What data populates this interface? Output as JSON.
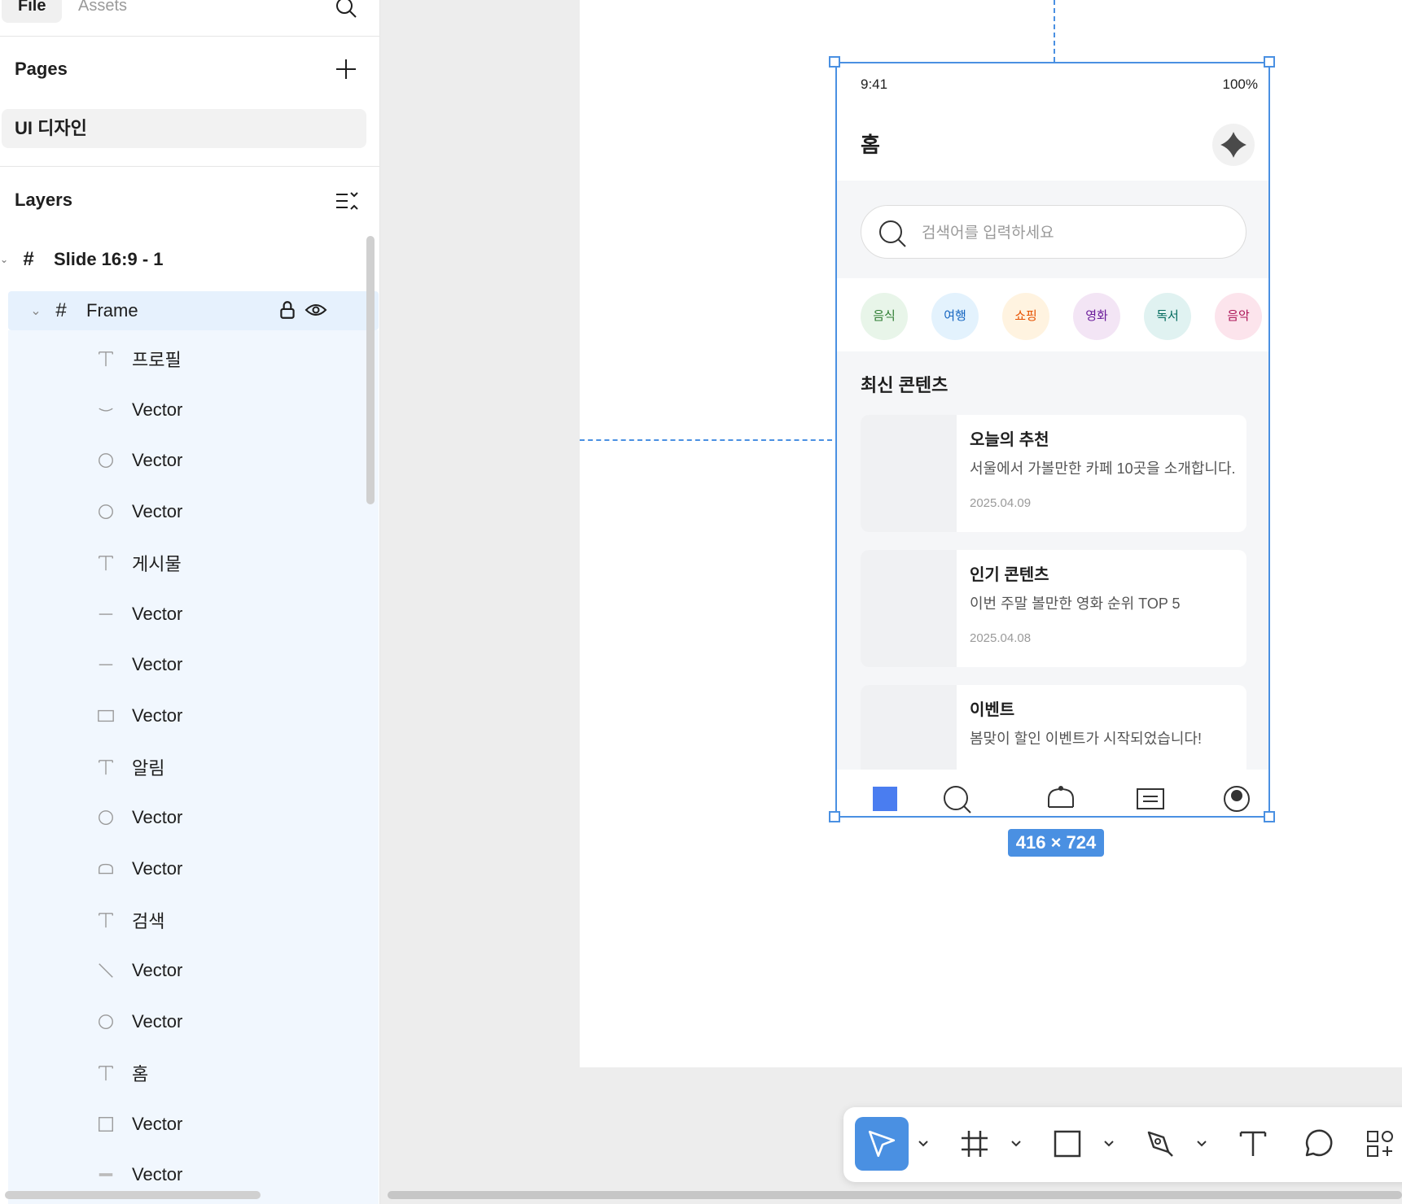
{
  "sidebar": {
    "tabs": {
      "file": "File",
      "assets": "Assets"
    },
    "pages_title": "Pages",
    "page_item": "UI 디자인",
    "layers_title": "Layers",
    "slide_name": "Slide 16:9 - 1",
    "frame_name": "Frame",
    "layers": [
      {
        "label": "프로필",
        "icon": "text"
      },
      {
        "label": "Vector",
        "icon": "arc"
      },
      {
        "label": "Vector",
        "icon": "circle"
      },
      {
        "label": "Vector",
        "icon": "circle"
      },
      {
        "label": "게시물",
        "icon": "text"
      },
      {
        "label": "Vector",
        "icon": "line"
      },
      {
        "label": "Vector",
        "icon": "line"
      },
      {
        "label": "Vector",
        "icon": "rect"
      },
      {
        "label": "알림",
        "icon": "text"
      },
      {
        "label": "Vector",
        "icon": "circle"
      },
      {
        "label": "Vector",
        "icon": "half-rect"
      },
      {
        "label": "검색",
        "icon": "text"
      },
      {
        "label": "Vector",
        "icon": "diagonal"
      },
      {
        "label": "Vector",
        "icon": "circle"
      },
      {
        "label": "홈",
        "icon": "text"
      },
      {
        "label": "Vector",
        "icon": "square"
      },
      {
        "label": "Vector",
        "icon": "bar"
      }
    ]
  },
  "canvas": {
    "dimension_label": "416 × 724",
    "accent": "#4a90e2"
  },
  "phone": {
    "time": "9:41",
    "battery": "100%",
    "title": "홈",
    "search_placeholder": "검색어를 입력하세요",
    "chips": [
      {
        "label": "음식",
        "bg": "#e8f5e9",
        "fg": "#2e7d32"
      },
      {
        "label": "여행",
        "bg": "#e3f2fd",
        "fg": "#1565c0"
      },
      {
        "label": "쇼핑",
        "bg": "#fff3e0",
        "fg": "#e65100"
      },
      {
        "label": "영화",
        "bg": "#f3e5f5",
        "fg": "#6a1b9a"
      },
      {
        "label": "독서",
        "bg": "#e0f2f1",
        "fg": "#00695c"
      },
      {
        "label": "음악",
        "bg": "#fce4ec",
        "fg": "#ad1457"
      }
    ],
    "section_title": "최신 콘텐츠",
    "cards": [
      {
        "title": "오늘의 추천",
        "desc": "서울에서 가볼만한 카페 10곳을 소개합니다.",
        "date": "2025.04.09"
      },
      {
        "title": "인기 콘텐츠",
        "desc": "이번 주말 볼만한 영화 순위 TOP 5",
        "date": "2025.04.08"
      },
      {
        "title": "이벤트",
        "desc": "봄맞이 할인 이벤트가 시작되었습니다!",
        "date": ""
      }
    ],
    "nav_active_color": "#4a7df0"
  }
}
